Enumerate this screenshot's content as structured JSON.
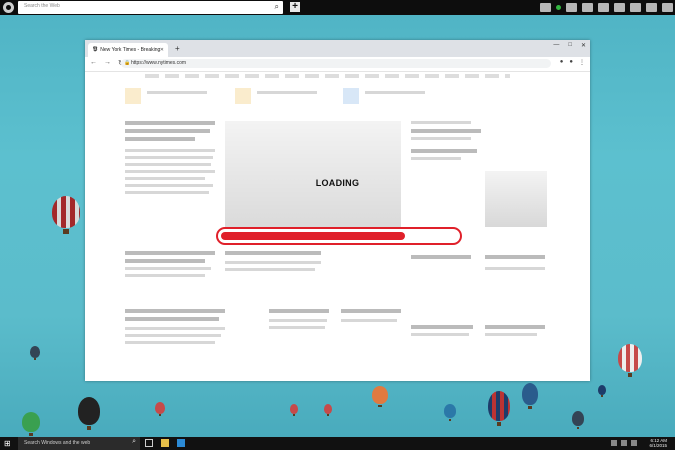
{
  "topbar": {
    "search_placeholder": "Search the Web",
    "icons": [
      "circle-menu-icon",
      "search-icon",
      "new-tab-plus-icon",
      "tray-icons"
    ]
  },
  "browser": {
    "tab_title": "New York Times - Breaking New",
    "url": "https://www.nytimes.com",
    "window_controls": [
      "minimize",
      "maximize",
      "close"
    ]
  },
  "overlay": {
    "loading_label": "LOADING",
    "progress_fraction": 0.78,
    "accent_color": "#e0202a"
  },
  "taskbar": {
    "search_placeholder": "Search Windows and the web",
    "time": "6:12 AM",
    "date": "6/1/2015"
  }
}
